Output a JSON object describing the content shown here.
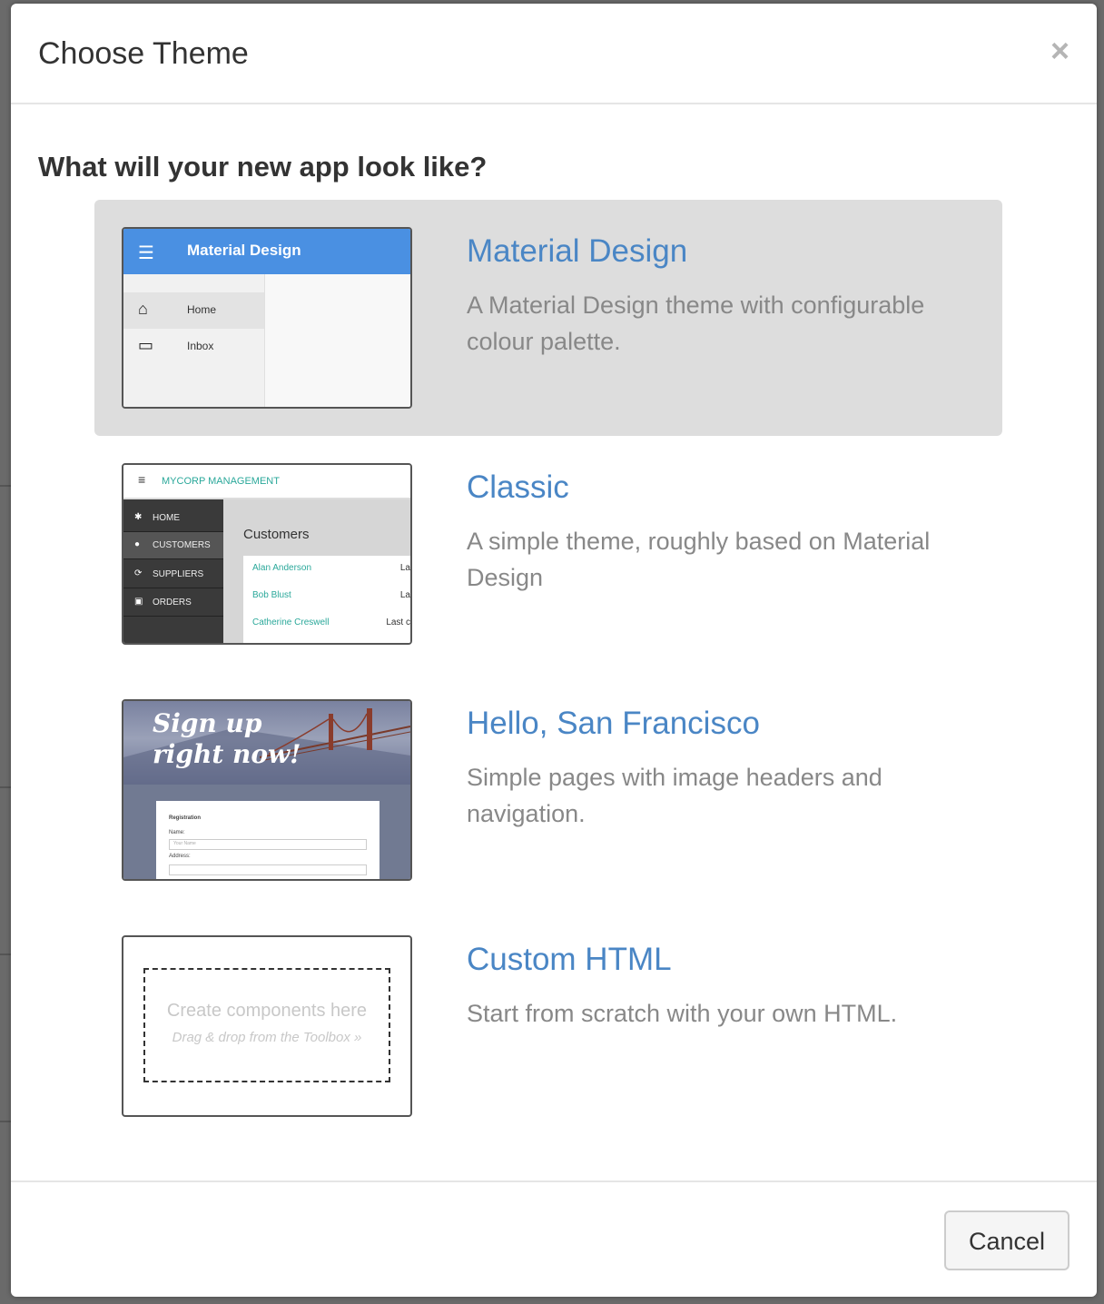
{
  "modal": {
    "title": "Choose Theme",
    "close_label": "×",
    "question": "What will your new app look like?"
  },
  "themes": [
    {
      "name": "Material Design",
      "description": "A Material Design theme with configurable colour palette.",
      "selected": true,
      "thumbnail": {
        "app_title": "Material Design",
        "menu_items": [
          "Home",
          "Inbox"
        ],
        "accent": "#4a90e2"
      }
    },
    {
      "name": "Classic",
      "description": "A simple theme, roughly based on Material Design",
      "selected": false,
      "thumbnail": {
        "app_title": "MYCORP MANAGEMENT",
        "menu_items": [
          "HOME",
          "CUSTOMERS",
          "SUPPLIERS",
          "ORDERS"
        ],
        "page_title": "Customers",
        "rows": [
          {
            "name": "Alan Anderson",
            "last": "La"
          },
          {
            "name": "Bob Blust",
            "last": "La"
          },
          {
            "name": "Catherine Creswell",
            "last": "Last c"
          }
        ],
        "accent": "#2aa89a"
      }
    },
    {
      "name": "Hello, San Francisco",
      "description": "Simple pages with image headers and navigation.",
      "selected": false,
      "thumbnail": {
        "headline_line1": "Sign up",
        "headline_line2": "right now!",
        "form_title": "Registration",
        "field1_label": "Name:",
        "field1_placeholder": "Your Name",
        "field2_label": "Address:"
      }
    },
    {
      "name": "Custom HTML",
      "description": "Start from scratch with your own HTML.",
      "selected": false,
      "thumbnail": {
        "line1": "Create components here",
        "line2": "Drag & drop from the Toolbox »"
      }
    }
  ],
  "footer": {
    "cancel_label": "Cancel"
  }
}
